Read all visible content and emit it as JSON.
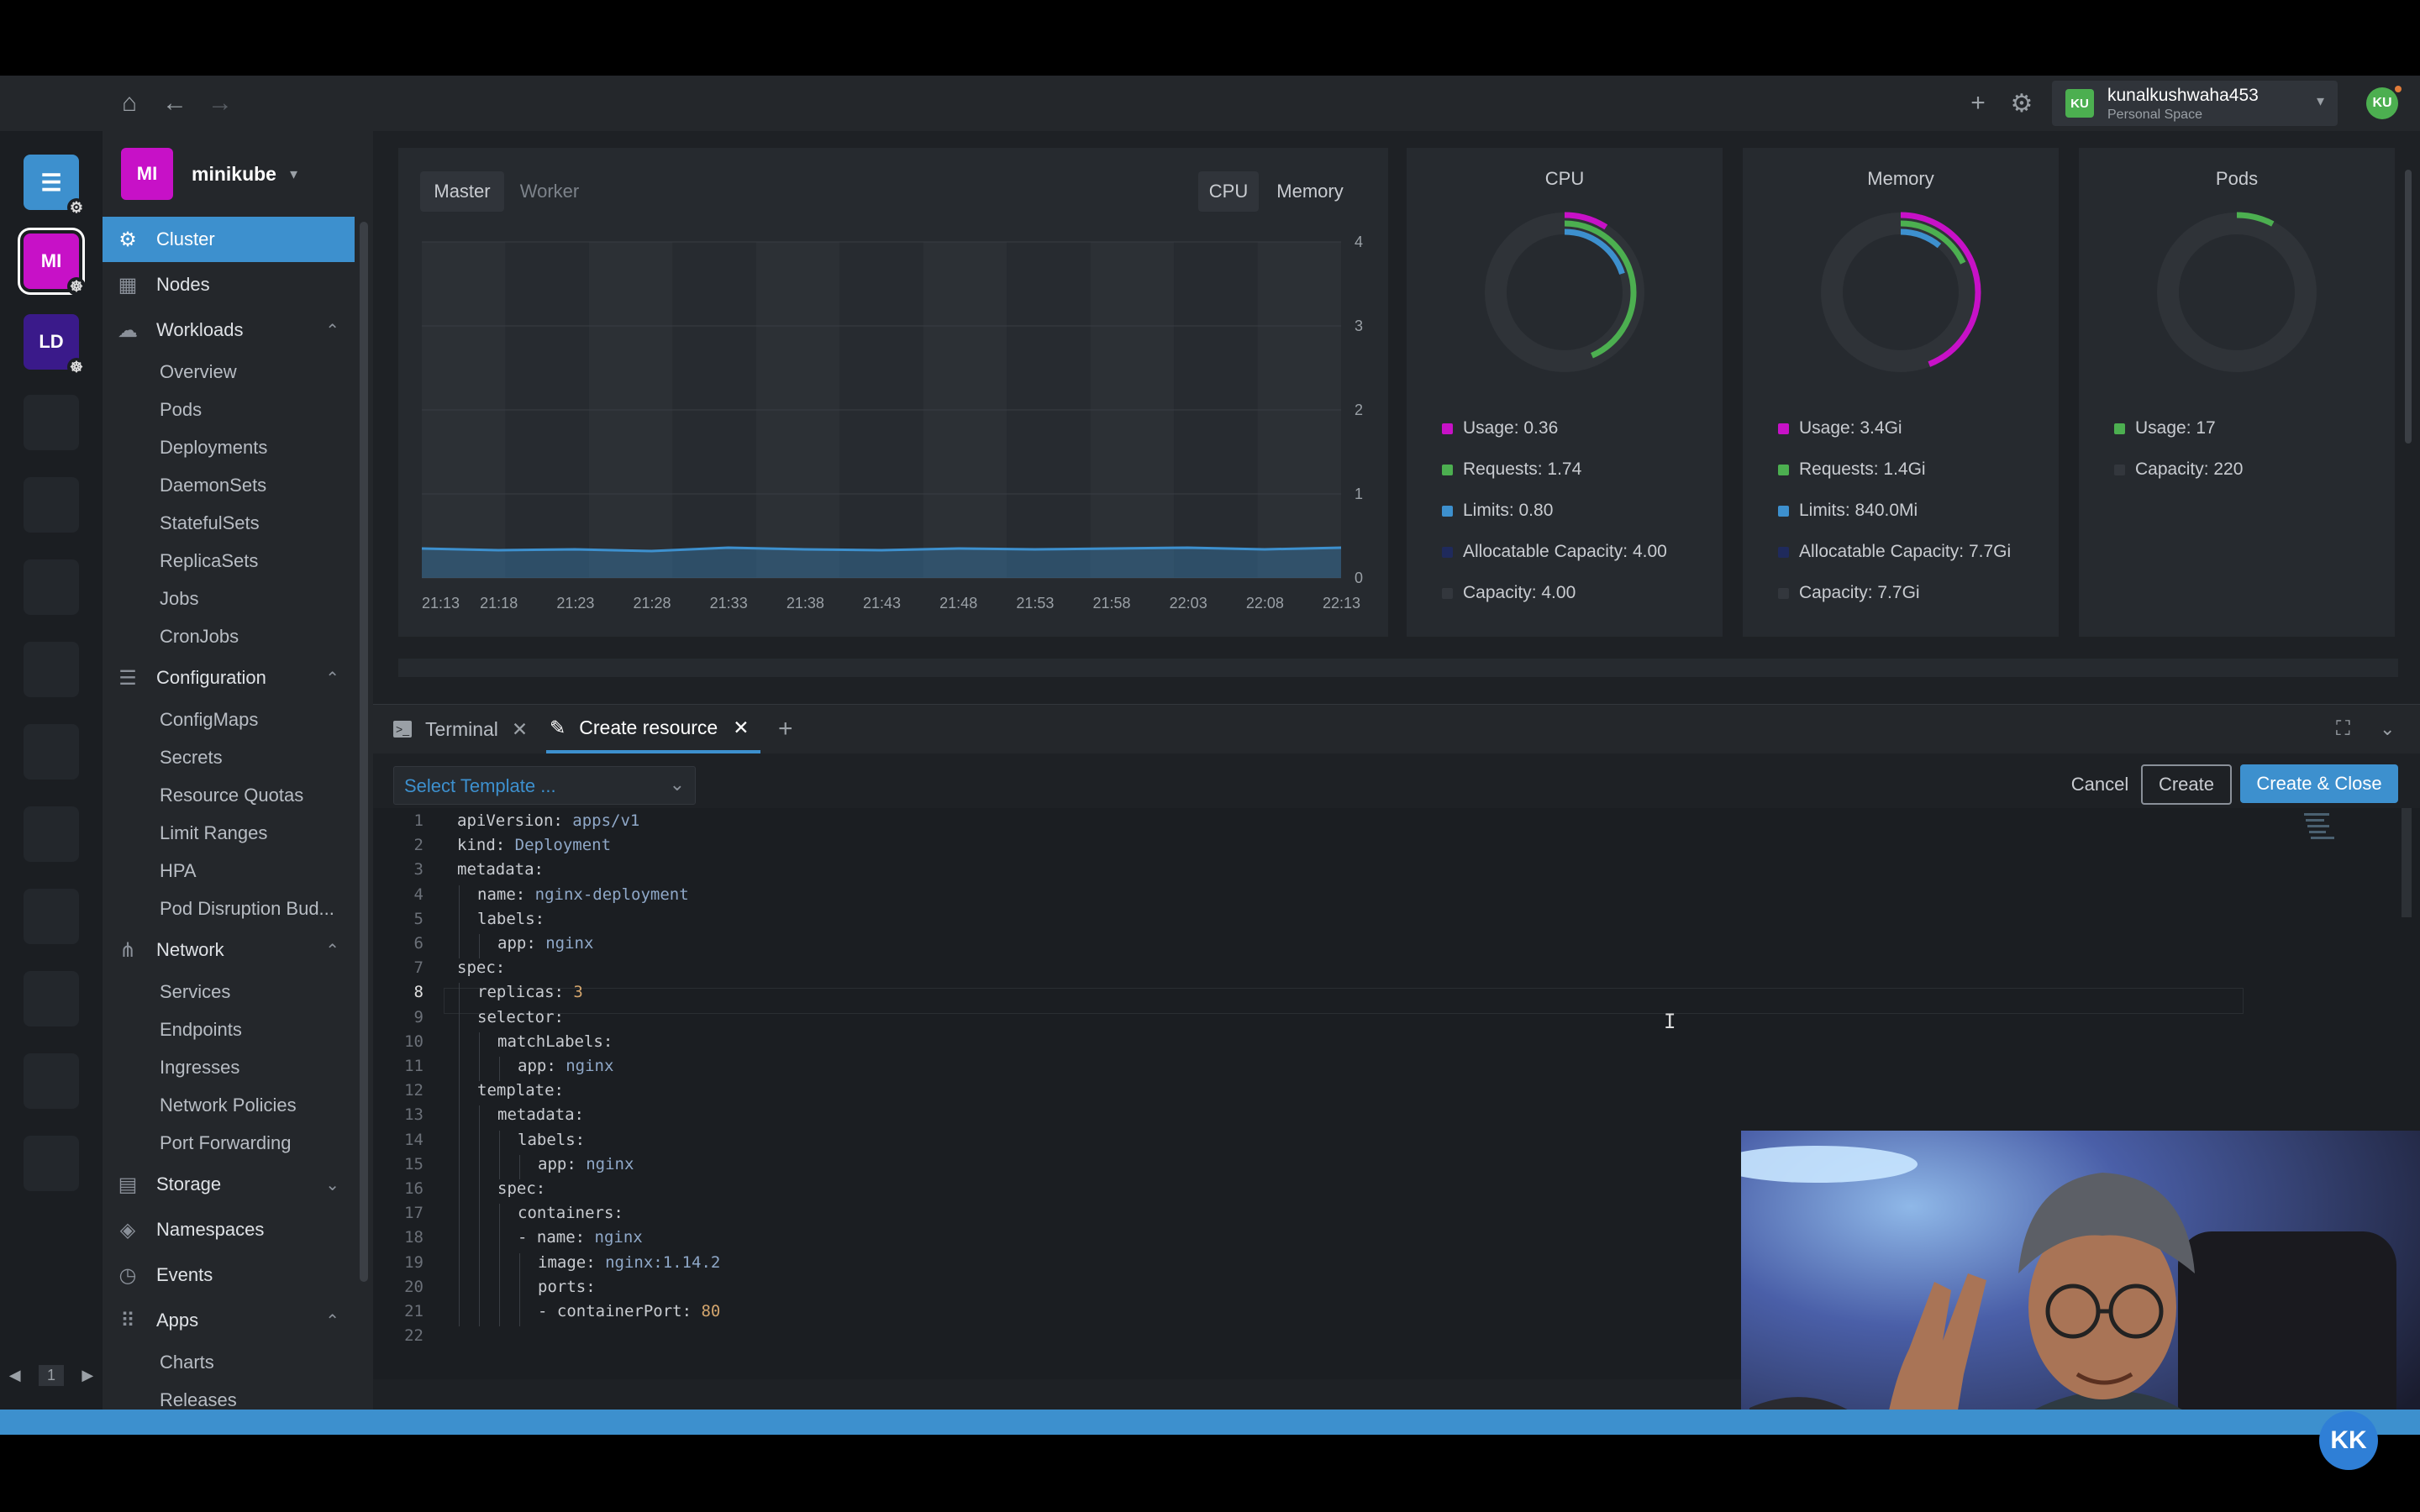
{
  "topbar": {
    "icons": [
      "home-icon",
      "back-arrow-icon",
      "forward-arrow-icon",
      "plus-icon",
      "gear-icon"
    ],
    "user": {
      "initials": "KU",
      "name": "kunalkushwaha453",
      "space": "Personal Space"
    },
    "profile_initials": "KU"
  },
  "hotbar": {
    "items": [
      {
        "label": "",
        "icon": "catalog-icon",
        "color": "#3d90ce"
      },
      {
        "label": "MI",
        "color": "#c711c7"
      },
      {
        "label": "LD",
        "color": "#3a1a8a"
      }
    ],
    "page": "1"
  },
  "sidebar": {
    "cluster_initials": "MI",
    "cluster_name": "minikube",
    "items": [
      {
        "label": "Cluster",
        "icon": "cluster-icon",
        "active": true
      },
      {
        "label": "Nodes",
        "icon": "nodes-icon"
      },
      {
        "label": "Workloads",
        "icon": "workloads-icon",
        "expanded": true,
        "children": [
          "Overview",
          "Pods",
          "Deployments",
          "DaemonSets",
          "StatefulSets",
          "ReplicaSets",
          "Jobs",
          "CronJobs"
        ]
      },
      {
        "label": "Configuration",
        "icon": "configuration-icon",
        "expanded": true,
        "children": [
          "ConfigMaps",
          "Secrets",
          "Resource Quotas",
          "Limit Ranges",
          "HPA",
          "Pod Disruption Bud..."
        ]
      },
      {
        "label": "Network",
        "icon": "network-icon",
        "expanded": true,
        "children": [
          "Services",
          "Endpoints",
          "Ingresses",
          "Network Policies",
          "Port Forwarding"
        ]
      },
      {
        "label": "Storage",
        "icon": "storage-icon",
        "expanded": false
      },
      {
        "label": "Namespaces",
        "icon": "namespaces-icon"
      },
      {
        "label": "Events",
        "icon": "events-icon"
      },
      {
        "label": "Apps",
        "icon": "apps-icon",
        "expanded": true,
        "children": [
          "Charts",
          "Releases"
        ]
      }
    ]
  },
  "overview": {
    "node_tabs": [
      "Master",
      "Worker"
    ],
    "metric_tabs": [
      "CPU",
      "Memory"
    ],
    "chart_data": {
      "type": "line",
      "x": [
        "21:13",
        "21:18",
        "21:23",
        "21:28",
        "21:33",
        "21:38",
        "21:43",
        "21:48",
        "21:53",
        "21:58",
        "22:03",
        "22:08",
        "22:13"
      ],
      "y": [
        0.35,
        0.33,
        0.34,
        0.32,
        0.36,
        0.34,
        0.33,
        0.35,
        0.34,
        0.35,
        0.36,
        0.34,
        0.36
      ],
      "ylim": [
        0,
        4
      ],
      "yticks": [
        "0",
        "1",
        "2",
        "3",
        "4"
      ],
      "color": "#3d90ce"
    },
    "cards": [
      {
        "title": "CPU",
        "rings": [
          {
            "fraction": 0.09,
            "color": "#c711c7"
          },
          {
            "fraction": 0.435,
            "color": "#4caf50"
          },
          {
            "fraction": 0.2,
            "color": "#3d90ce"
          }
        ],
        "legend": [
          {
            "label": "Usage: 0.36",
            "color": "#c711c7"
          },
          {
            "label": "Requests: 1.74",
            "color": "#4caf50"
          },
          {
            "label": "Limits: 0.80",
            "color": "#3d90ce"
          },
          {
            "label": "Allocatable Capacity: 4.00",
            "color": "#1f2a5c"
          },
          {
            "label": "Capacity: 4.00",
            "color": "#33373d"
          }
        ]
      },
      {
        "title": "Memory",
        "rings": [
          {
            "fraction": 0.44,
            "color": "#c711c7"
          },
          {
            "fraction": 0.18,
            "color": "#4caf50"
          },
          {
            "fraction": 0.11,
            "color": "#3d90ce"
          }
        ],
        "legend": [
          {
            "label": "Usage: 3.4Gi",
            "color": "#c711c7"
          },
          {
            "label": "Requests: 1.4Gi",
            "color": "#4caf50"
          },
          {
            "label": "Limits: 840.0Mi",
            "color": "#3d90ce"
          },
          {
            "label": "Allocatable Capacity: 7.7Gi",
            "color": "#1f2a5c"
          },
          {
            "label": "Capacity: 7.7Gi",
            "color": "#33373d"
          }
        ]
      },
      {
        "title": "Pods",
        "rings": [
          {
            "fraction": 0.077,
            "color": "#4caf50"
          }
        ],
        "legend": [
          {
            "label": "Usage: 17",
            "color": "#4caf50"
          },
          {
            "label": "Capacity: 220",
            "color": "#33373d"
          }
        ]
      }
    ]
  },
  "dock": {
    "tabs": [
      {
        "label": "Terminal",
        "icon": "terminal-icon"
      },
      {
        "label": "Create resource",
        "icon": "pencil-icon",
        "active": true
      }
    ],
    "template_placeholder": "Select Template ...",
    "buttons": {
      "cancel": "Cancel",
      "create": "Create",
      "create_close": "Create & Close"
    },
    "code": [
      {
        "indent": 0,
        "key": "apiVersion",
        "val": "apps/v1"
      },
      {
        "indent": 0,
        "key": "kind",
        "val": "Deployment"
      },
      {
        "indent": 0,
        "key": "metadata",
        "val": ""
      },
      {
        "indent": 1,
        "key": "name",
        "val": "nginx-deployment"
      },
      {
        "indent": 1,
        "key": "labels",
        "val": ""
      },
      {
        "indent": 2,
        "key": "app",
        "val": "nginx"
      },
      {
        "indent": 0,
        "key": "spec",
        "val": ""
      },
      {
        "indent": 1,
        "key": "replicas",
        "val": "3",
        "num": true
      },
      {
        "indent": 1,
        "key": "selector",
        "val": ""
      },
      {
        "indent": 2,
        "key": "matchLabels",
        "val": ""
      },
      {
        "indent": 3,
        "key": "app",
        "val": "nginx"
      },
      {
        "indent": 1,
        "key": "template",
        "val": ""
      },
      {
        "indent": 2,
        "key": "metadata",
        "val": ""
      },
      {
        "indent": 3,
        "key": "labels",
        "val": ""
      },
      {
        "indent": 4,
        "key": "app",
        "val": "nginx"
      },
      {
        "indent": 2,
        "key": "spec",
        "val": ""
      },
      {
        "indent": 3,
        "key": "containers",
        "val": ""
      },
      {
        "indent": 3,
        "key": "- name",
        "val": "nginx"
      },
      {
        "indent": 4,
        "key": "image",
        "val": "nginx:1.14.2"
      },
      {
        "indent": 4,
        "key": "ports",
        "val": ""
      },
      {
        "indent": 4,
        "key": "- containerPort",
        "val": "80",
        "num": true
      },
      {
        "indent": 0,
        "key": "",
        "val": ""
      }
    ]
  }
}
